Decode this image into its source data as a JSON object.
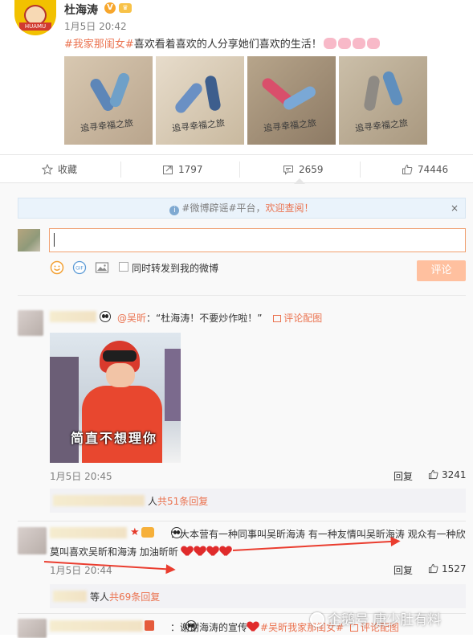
{
  "post": {
    "author": "杜海涛",
    "avatar_banner_text": "HUAMU",
    "time": "1月5日 20:42",
    "hashtag": "#我家那闺女#",
    "text": "喜欢看着喜欢的人分享她们喜欢的生活！",
    "photo_captions": [
      "追寻幸福之旅",
      "追寻幸福之旅",
      "追寻幸福之旅",
      "追寻幸福之旅"
    ]
  },
  "actions": {
    "favorite_label": "收藏",
    "repost_count": "1797",
    "comment_count": "2659",
    "like_count": "74446"
  },
  "notice": {
    "text_prefix": "#微博辟谣#平台，",
    "link": "欢迎查阅！",
    "close": "×"
  },
  "composer": {
    "input_value": "",
    "also_repost_label": "同时转发到我的微博",
    "submit_label": "评论"
  },
  "comments": [
    {
      "mention": "@吴昕",
      "text": "：“杜海涛！不要炒作啦！”",
      "pic_link": "评论配图",
      "image_subtitle": "简直不想理你",
      "time": "1月5日 20:45",
      "reply_label": "回复",
      "likes": "3241",
      "replies_prefix": "人",
      "replies_link": "共51条回复"
    },
    {
      "text_line1": "：大本营有一种同事叫吴昕海涛 有一种友情叫吴昕海涛 观众有一种欣",
      "text_line2": "莫叫喜欢吴昕和海涛 加油昕昕",
      "time": "1月5日 20:44",
      "reply_label": "回复",
      "likes": "1527",
      "replies_prefix": "等人",
      "replies_link": "共69条回复"
    },
    {
      "text": "：谢谢海涛的宣传",
      "tags": "#吴昕我家那闺女#",
      "pic_link": "评论配图"
    }
  ],
  "watermark": "企鹅号 唐少肚有料",
  "colors": {
    "link": "#eb7350",
    "submit_bg": "#ffc09f",
    "notice_bg": "#eaf3fb",
    "arrow": "#ea3d2f"
  }
}
